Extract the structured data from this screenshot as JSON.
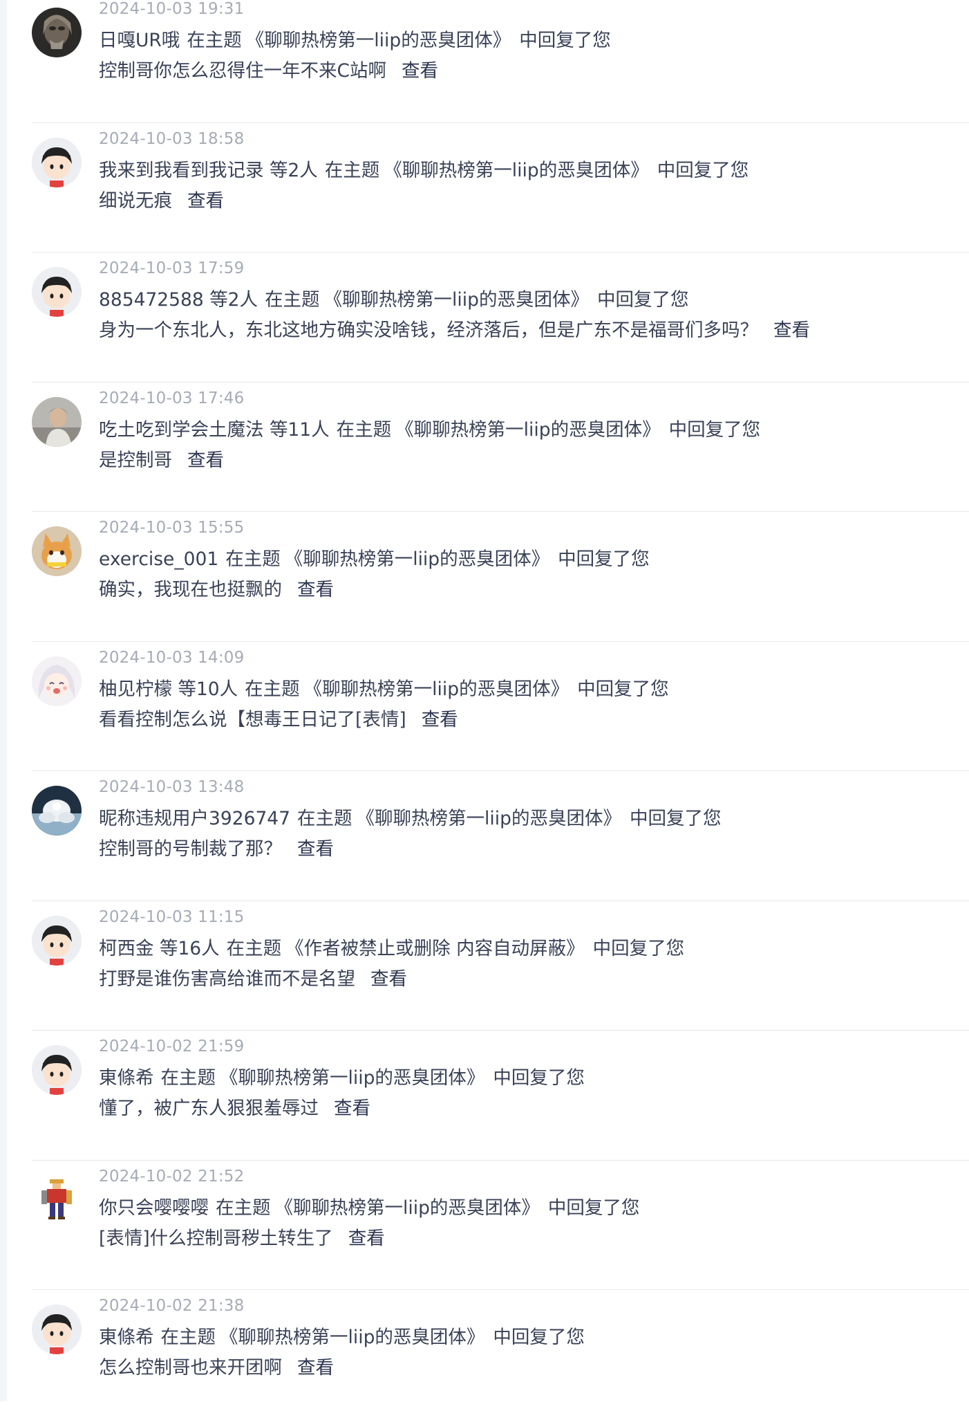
{
  "notifications": [
    {
      "time": "2024-10-03 19:31",
      "user": "日嘎UR哦",
      "extra": "",
      "in_topic": "在主题",
      "topic": "《聊聊热榜第一liip的恶臭团体》",
      "replied": "中回复了您",
      "content": "控制哥你怎么忍得住一年不来C站啊",
      "view": "查看",
      "avatar": "dark-photo-avatar"
    },
    {
      "time": "2024-10-03 18:58",
      "user": "我来到我看到我记录",
      "extra": "等2人",
      "in_topic": "在主题",
      "topic": "《聊聊热榜第一liip的恶臭团体》",
      "replied": "中回复了您",
      "content": "细说无痕",
      "view": "查看",
      "avatar": "default-avatar"
    },
    {
      "time": "2024-10-03 17:59",
      "user": "885472588",
      "extra": "等2人",
      "in_topic": "在主题",
      "topic": "《聊聊热榜第一liip的恶臭团体》",
      "replied": "中回复了您",
      "content": "身为一个东北人，东北这地方确实没啥钱，经济落后，但是广东不是福哥们多吗？",
      "view": "查看",
      "avatar": "default-avatar"
    },
    {
      "time": "2024-10-03 17:46",
      "user": "吃土吃到学会土魔法",
      "extra": "等11人",
      "in_topic": "在主题",
      "topic": "《聊聊热榜第一liip的恶臭团体》",
      "replied": "中回复了您",
      "content": "是控制哥",
      "view": "查看",
      "avatar": "photo-avatar"
    },
    {
      "time": "2024-10-03 15:55",
      "user": "exercise_001",
      "extra": "",
      "in_topic": "在主题",
      "topic": "《聊聊热榜第一liip的恶臭团体》",
      "replied": "中回复了您",
      "content": "确实，我现在也挺飘的",
      "view": "查看",
      "avatar": "cat-avatar"
    },
    {
      "time": "2024-10-03 14:09",
      "user": "柚见柠檬",
      "extra": "等10人",
      "in_topic": "在主题",
      "topic": "《聊聊热榜第一liip的恶臭团体》",
      "replied": "中回复了您",
      "content": "看看控制怎么说【想毒王日记了[表情]",
      "view": "查看",
      "avatar": "anime-avatar"
    },
    {
      "time": "2024-10-03 13:48",
      "user": "昵称违规用户3926747",
      "extra": "",
      "in_topic": "在主题",
      "topic": "《聊聊热榜第一liip的恶臭团体》",
      "replied": "中回复了您",
      "content": "控制哥的号制裁了那？",
      "view": "查看",
      "avatar": "white-figure-avatar"
    },
    {
      "time": "2024-10-03 11:15",
      "user": "柯西金",
      "extra": "等16人",
      "in_topic": "在主题",
      "topic": "《作者被禁止或删除 内容自动屏蔽》",
      "replied": "中回复了您",
      "content": "打野是谁伤害高给谁而不是名望",
      "view": "查看",
      "avatar": "default-avatar"
    },
    {
      "time": "2024-10-02 21:59",
      "user": "東條希",
      "extra": "",
      "in_topic": "在主题",
      "topic": "《聊聊热榜第一liip的恶臭团体》",
      "replied": "中回复了您",
      "content": "懂了，被广东人狠狠羞辱过",
      "view": "查看",
      "avatar": "default-avatar"
    },
    {
      "time": "2024-10-02 21:52",
      "user": "你只会嘤嘤嘤",
      "extra": "",
      "in_topic": "在主题",
      "topic": "《聊聊热榜第一liip的恶臭团体》",
      "replied": "中回复了您",
      "content": "[表情]什么控制哥秽土转生了",
      "view": "查看",
      "avatar": "pixel-warrior-avatar"
    },
    {
      "time": "2024-10-02 21:38",
      "user": "東條希",
      "extra": "",
      "in_topic": "在主题",
      "topic": "《聊聊热榜第一liip的恶臭团体》",
      "replied": "中回复了您",
      "content": "怎么控制哥也来开团啊",
      "view": "查看",
      "avatar": "default-avatar"
    }
  ]
}
